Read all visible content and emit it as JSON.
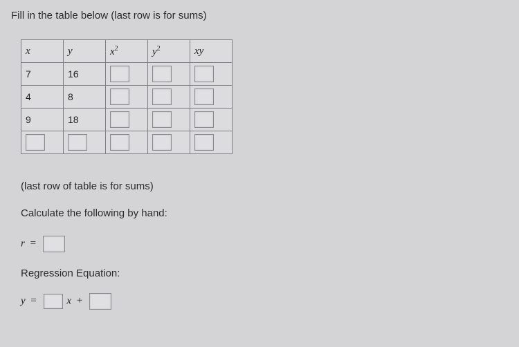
{
  "instruction": "Fill in the table below (last row is for sums)",
  "headers": {
    "x": "x",
    "y": "y",
    "x2_base": "x",
    "x2_exp": "2",
    "y2_base": "y",
    "y2_exp": "2",
    "xy": "xy"
  },
  "rows": [
    {
      "x": "7",
      "y": "16"
    },
    {
      "x": "4",
      "y": "8"
    },
    {
      "x": "9",
      "y": "18"
    }
  ],
  "note": "(last row of table is for sums)",
  "calculate": "Calculate the following by hand:",
  "r_label": "r",
  "eq_sign": "=",
  "regression_label": "Regression Equation:",
  "yhat": "y",
  "x_var": "x",
  "plus": "+"
}
